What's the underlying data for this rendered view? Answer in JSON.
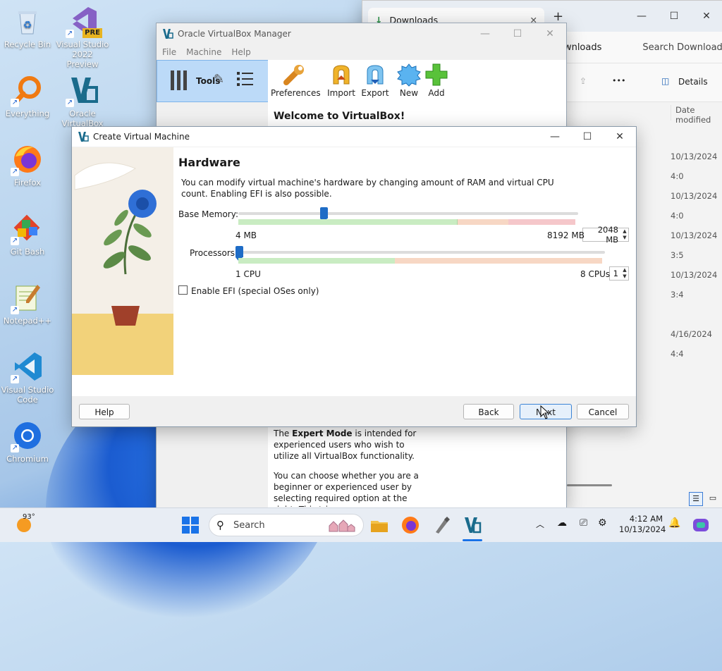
{
  "desktop": {
    "icons": [
      {
        "label": "Recycle Bin"
      },
      {
        "label": "Visual Studio 2022 Preview"
      },
      {
        "label": "Everything"
      },
      {
        "label": "Oracle VirtualBox"
      },
      {
        "label": "Firefox"
      },
      {
        "label": "Git Bash"
      },
      {
        "label": "Notepad++"
      },
      {
        "label": "Visual Studio Code"
      },
      {
        "label": "Chromium"
      }
    ],
    "vs_badge": "PRE"
  },
  "explorer": {
    "tab_title": "Downloads",
    "breadcrumb": "ownloads",
    "search_placeholder": "Search Download",
    "more": "•••",
    "details_label": "Details",
    "column_header": "Date modified",
    "dates": [
      "10/13/2024 4:0",
      "10/13/2024 4:0",
      "10/13/2024 3:5",
      "10/13/2024 3:4",
      "4/16/2024 4:4"
    ]
  },
  "vbox_manager": {
    "title": "Oracle VirtualBox Manager",
    "menu": [
      "File",
      "Machine",
      "Help"
    ],
    "tools_label": "Tools",
    "toolbar": {
      "preferences": "Preferences",
      "import": "Import",
      "export": "Export",
      "new": "New",
      "add": "Add"
    },
    "welcome": "Welcome to VirtualBox!",
    "expert_text_1a": "The ",
    "expert_text_1b": "Expert Mode",
    "expert_text_1c": " is intended for experienced users who wish to utilize all VirtualBox functionality.",
    "expert_text_2": "You can choose whether you are a beginner or experienced user by selecting required option at the right. This trim..."
  },
  "dialog": {
    "title": "Create Virtual Machine",
    "heading": "Hardware",
    "description": "You can modify virtual machine's hardware by changing amount of RAM and virtual CPU count. Enabling EFI is also possible.",
    "memory": {
      "label": "Base Memory:",
      "value": "2048 MB",
      "min_label": "4 MB",
      "max_label": "8192 MB",
      "fraction": 0.25
    },
    "processors": {
      "label": "Processors:",
      "value": "1",
      "min_label": "1 CPU",
      "max_label": "8 CPUs",
      "fraction": 0.0
    },
    "efi_label": "Enable EFI (special OSes only)",
    "efi_checked": false,
    "buttons": {
      "help": "Help",
      "back": "Back",
      "next": "Next",
      "cancel": "Cancel"
    }
  },
  "taskbar": {
    "weather_temp": "93°",
    "search_placeholder": "Search",
    "time": "4:12 AM",
    "date": "10/13/2024"
  }
}
